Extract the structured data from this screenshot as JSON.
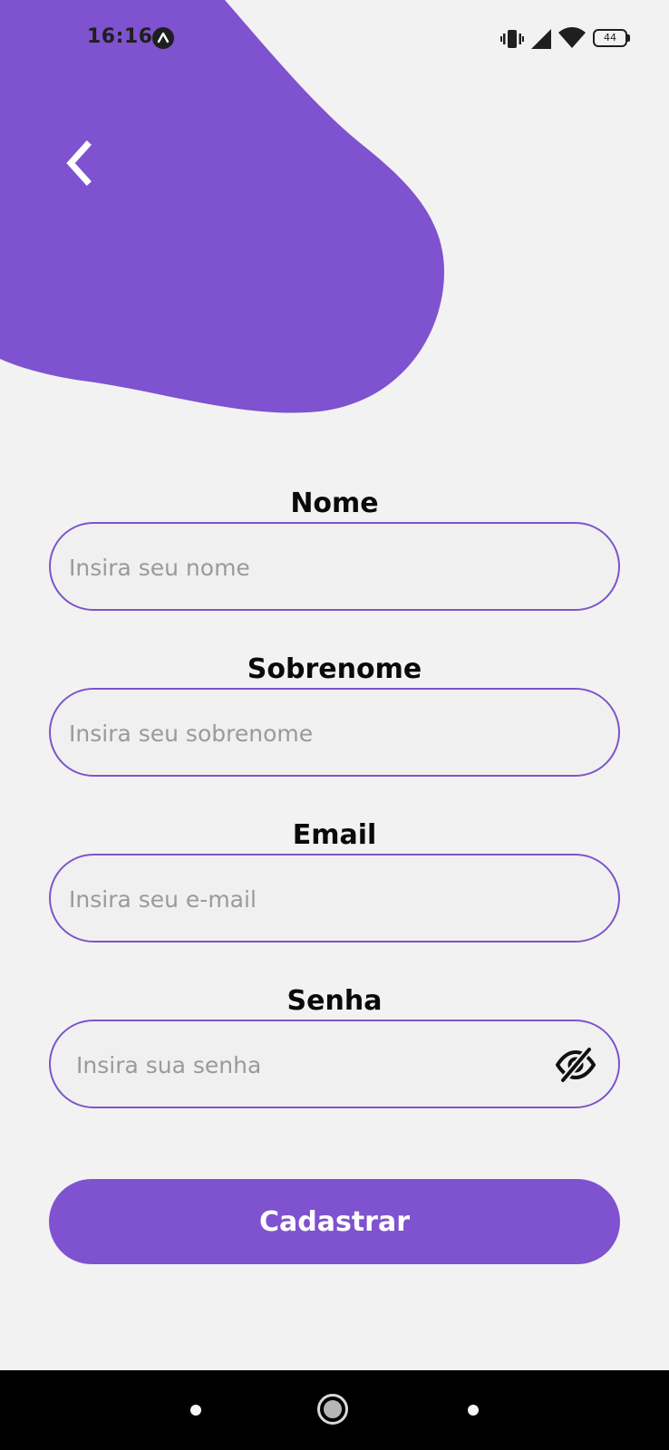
{
  "theme": {
    "accent": "#7f52cf",
    "background": "#f2f2f3",
    "input_border": "#7d55c7"
  },
  "status_bar": {
    "time": "16:16",
    "battery_level": "44",
    "icons": [
      "app-notification-icon",
      "vibrate-icon",
      "signal-icon",
      "wifi-icon",
      "battery-icon"
    ]
  },
  "header": {
    "back_icon": "chevron-left-icon"
  },
  "form": {
    "fields": [
      {
        "label": "Nome",
        "placeholder": "Insira seu nome",
        "value": ""
      },
      {
        "label": "Sobrenome",
        "placeholder": "Insira seu sobrenome",
        "value": ""
      },
      {
        "label": "Email",
        "placeholder": "Insira seu e-mail",
        "value": ""
      },
      {
        "label": "Senha",
        "placeholder": "Insira sua senha",
        "value": "",
        "toggle_icon": "eye-off-icon"
      }
    ],
    "submit_label": "Cadastrar"
  },
  "nav_bar": {
    "items": [
      "recents-button",
      "home-button",
      "back-button"
    ]
  }
}
